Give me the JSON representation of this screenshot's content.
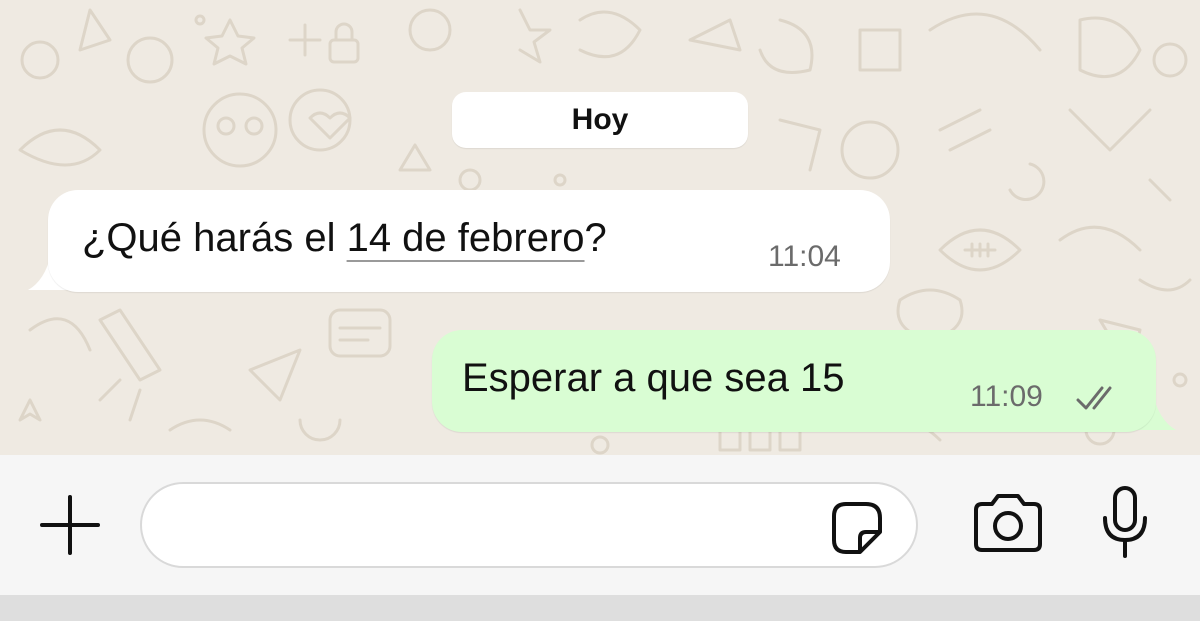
{
  "chat": {
    "date_label": "Hoy",
    "messages": [
      {
        "direction": "incoming",
        "text_before": "¿Qué harás el ",
        "link_text": "14 de febrero",
        "text_after": "?",
        "time": "11:04"
      },
      {
        "direction": "outgoing",
        "text": "Esperar a que sea 15",
        "time": "11:09",
        "status": "delivered-double-check"
      }
    ]
  },
  "composer": {
    "input_value": "",
    "icons": {
      "attach": "plus-icon",
      "sticker": "sticker-icon",
      "camera": "camera-icon",
      "mic": "microphone-icon"
    }
  },
  "colors": {
    "wallpaper": "#efeae2",
    "incoming_bubble": "#ffffff",
    "outgoing_bubble": "#d9fdd3",
    "time_text": "#6b6b6b",
    "read_ticks": "#6b6b6b"
  }
}
